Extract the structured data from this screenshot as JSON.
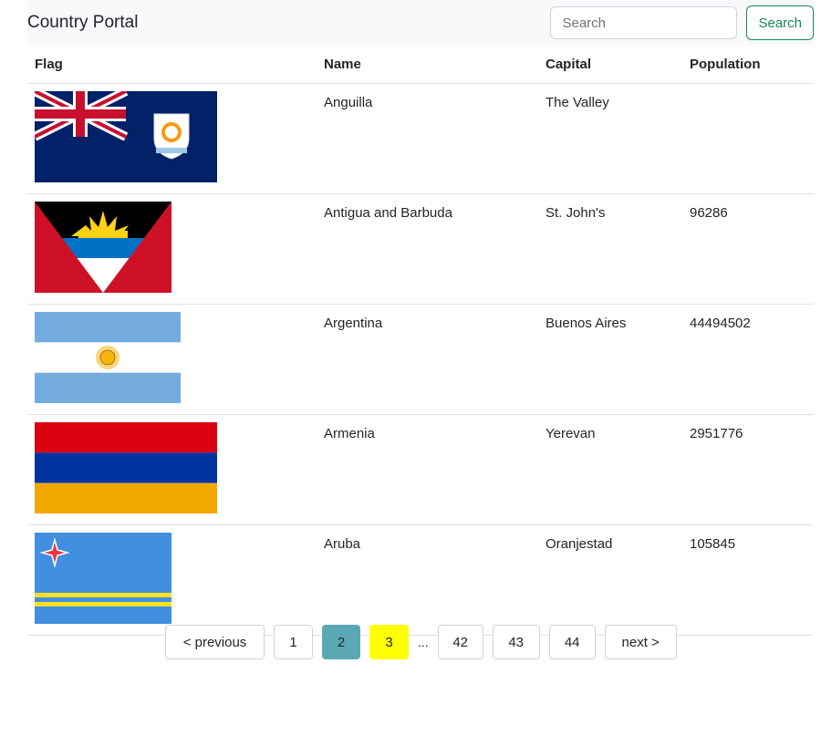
{
  "navbar": {
    "brand": "Country Portal"
  },
  "search": {
    "placeholder": "Search",
    "button_label": "Search",
    "value": ""
  },
  "table": {
    "headers": [
      "Flag",
      "Name",
      "Capital",
      "Population"
    ],
    "rows": [
      {
        "flag": "anguilla-flag",
        "name": "Anguilla",
        "capital": "The Valley",
        "population": ""
      },
      {
        "flag": "antigua-and-barbuda-flag",
        "name": "Antigua and Barbuda",
        "capital": "St. John's",
        "population": "96286"
      },
      {
        "flag": "argentina-flag",
        "name": "Argentina",
        "capital": "Buenos Aires",
        "population": "44494502"
      },
      {
        "flag": "armenia-flag",
        "name": "Armenia",
        "capital": "Yerevan",
        "population": "2951776"
      },
      {
        "flag": "aruba-flag",
        "name": "Aruba",
        "capital": "Oranjestad",
        "population": "105845"
      }
    ]
  },
  "pagination": {
    "previous_label": "< previous",
    "pages": [
      "1",
      "2",
      "3"
    ],
    "ellipsis": "...",
    "tail_pages": [
      "42",
      "43",
      "44"
    ],
    "next_label": "next >",
    "active_page": "2",
    "highlighted_page": "3"
  },
  "colors": {
    "active_page_bg": "#5ba8b5",
    "highlighted_page_bg": "#ffff00",
    "search_button": "#198754"
  }
}
